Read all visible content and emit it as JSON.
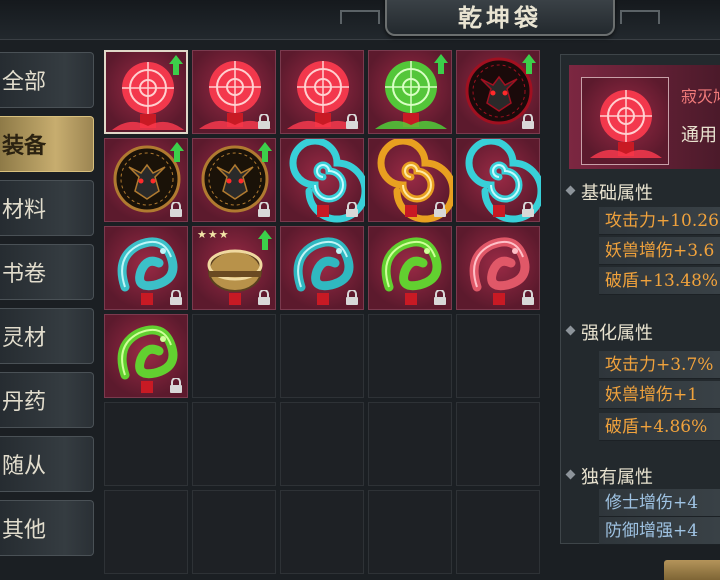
{
  "header": {
    "title": "乾坤袋"
  },
  "tabs": [
    {
      "label": "全部",
      "active": false
    },
    {
      "label": "装备",
      "active": true
    },
    {
      "label": "材料",
      "active": false
    },
    {
      "label": "书卷",
      "active": false
    },
    {
      "label": "灵材",
      "active": false
    },
    {
      "label": "丹药",
      "active": false
    },
    {
      "label": "随从",
      "active": false
    },
    {
      "label": "其他",
      "active": false
    }
  ],
  "inventory": {
    "items": [
      {
        "icon": "red-wheel-icon",
        "upgrade": true,
        "locked": false,
        "selected": true
      },
      {
        "icon": "red-wheel-icon",
        "upgrade": false,
        "locked": true
      },
      {
        "icon": "red-wheel-icon",
        "upgrade": false,
        "locked": true
      },
      {
        "icon": "green-wheel-icon",
        "upgrade": true,
        "locked": false
      },
      {
        "icon": "dark-dragon-emblem-icon",
        "upgrade": true,
        "locked": true
      },
      {
        "icon": "bronze-dragon-emblem-icon",
        "upgrade": true,
        "locked": true
      },
      {
        "icon": "bronze-dragon-emblem-icon",
        "upgrade": true,
        "locked": true
      },
      {
        "icon": "cyan-swirl-icon",
        "upgrade": false,
        "locked": true
      },
      {
        "icon": "gold-swirl-icon",
        "upgrade": false,
        "locked": true
      },
      {
        "icon": "cyan-swirl-icon",
        "upgrade": false,
        "locked": true
      },
      {
        "icon": "cyan-serpent-icon",
        "upgrade": false,
        "locked": true
      },
      {
        "icon": "bronze-bracer-icon",
        "upgrade": true,
        "locked": true,
        "stars": "★★★"
      },
      {
        "icon": "cyan-beast-mask-icon",
        "upgrade": false,
        "locked": true
      },
      {
        "icon": "green-dragon-icon",
        "upgrade": false,
        "locked": true
      },
      {
        "icon": "pink-dragon-icon",
        "upgrade": false,
        "locked": true
      },
      {
        "icon": "green-dragon-icon",
        "upgrade": false,
        "locked": true
      }
    ],
    "total_slots": 30
  },
  "detail": {
    "name": "寂灭鸠",
    "type": "通用",
    "sections": [
      {
        "title": "基础属性",
        "color": "orange",
        "stats": [
          "攻击力+10.26",
          "妖兽增伤+3.6",
          "破盾+13.48%"
        ]
      },
      {
        "title": "强化属性",
        "color": "orange",
        "stats": [
          "攻击力+3.7%",
          "妖兽增伤+1",
          "破盾+4.86%"
        ]
      },
      {
        "title": "独有属性",
        "color": "blue",
        "stats": [
          "修士增伤+4",
          "防御增强+4"
        ]
      }
    ]
  },
  "colors": {
    "orange": "#f0a23c",
    "blue": "#9fc3e3",
    "active_tab": "#c7ad6f",
    "upgrade_arrow": "#3ccf4a"
  }
}
